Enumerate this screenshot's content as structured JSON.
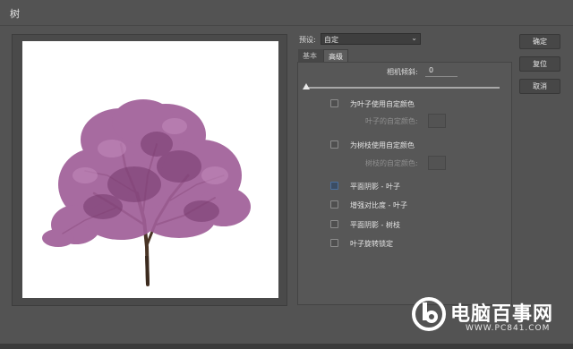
{
  "window": {
    "title": "树"
  },
  "preset": {
    "label": "预设:",
    "value": "自定",
    "chevron_icon": "chevron-down-icon"
  },
  "tabs": [
    {
      "label": "基本",
      "active": false
    },
    {
      "label": "高级",
      "active": true
    }
  ],
  "advanced": {
    "camera_tilt_label": "相机倾斜:",
    "camera_tilt_value": "0",
    "camera_tilt_slider_fraction": 0.0,
    "options": [
      {
        "label": "为叶子使用自定颜色",
        "checked": false
      },
      {
        "label": "为树枝使用自定颜色",
        "checked": false
      },
      {
        "label": "平面阴影 - 叶子",
        "checked": false,
        "focused": true
      },
      {
        "label": "增强对比度 - 叶子",
        "checked": false
      },
      {
        "label": "平面阴影 - 树枝",
        "checked": false
      },
      {
        "label": "叶子旋转锁定",
        "checked": false
      }
    ],
    "leaf_color_label": "叶子的自定颜色:",
    "branch_color_label": "树枝的自定颜色:"
  },
  "buttons": {
    "ok": "确定",
    "reset": "复位",
    "cancel": "取消"
  },
  "watermark": {
    "text": "电脑百事网",
    "url": "WWW.PC841.COM"
  },
  "colors": {
    "dialog_bg": "#535353",
    "blossom": "#a05f98",
    "trunk": "#4a3526"
  }
}
